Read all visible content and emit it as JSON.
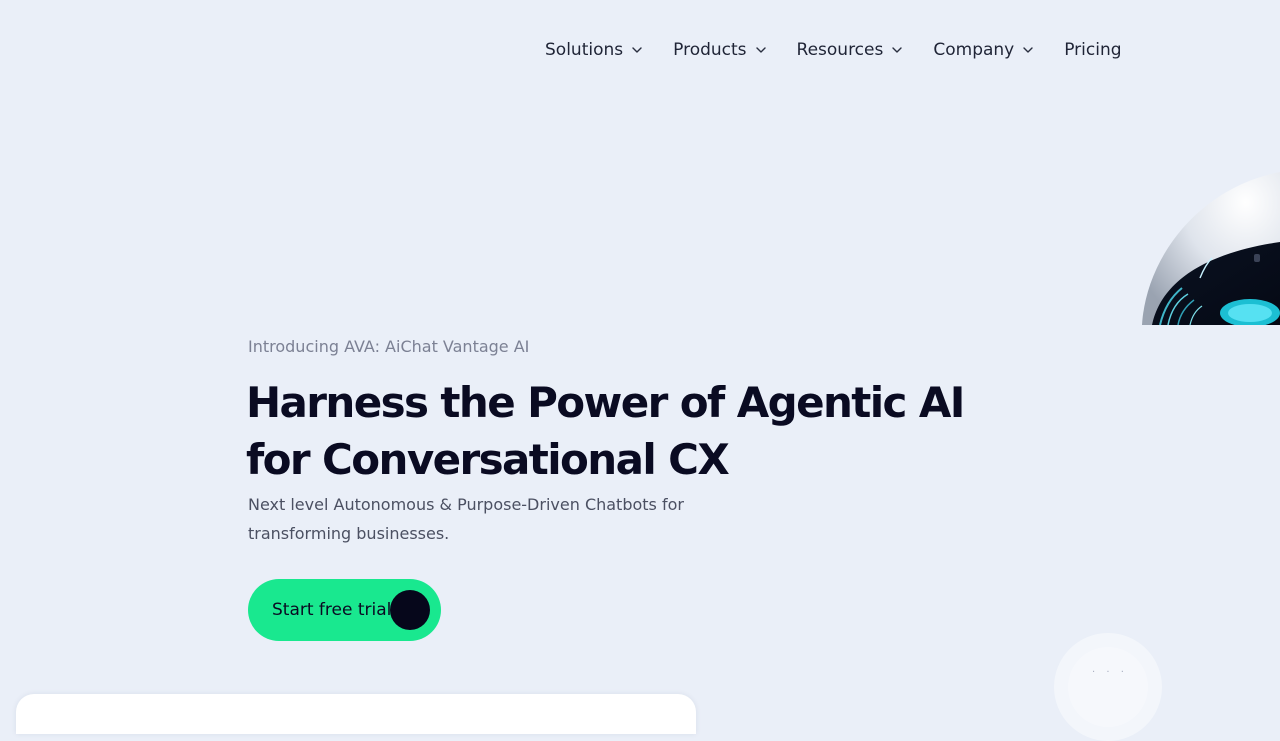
{
  "nav": {
    "items": [
      {
        "label": "Solutions",
        "has_dropdown": true
      },
      {
        "label": "Products",
        "has_dropdown": true
      },
      {
        "label": "Resources",
        "has_dropdown": true
      },
      {
        "label": "Company",
        "has_dropdown": true
      },
      {
        "label": "Pricing",
        "has_dropdown": false
      }
    ]
  },
  "hero": {
    "eyebrow": "Introducing AVA: AiChat Vantage AI",
    "headline_line1": "Harness the Power of Agentic AI",
    "headline_line2": "for Conversational CX",
    "subtext": "Next level Autonomous & Purpose-Driven Chatbots for transforming businesses.",
    "cta_label": "Start free trial"
  },
  "chat_widget": {
    "dots": "· · ·"
  },
  "colors": {
    "background": "#eaeff8",
    "accent_green": "#19e88f",
    "text_dark": "#0a0b22",
    "text_muted": "#7c8194"
  },
  "icons": {
    "nav_dropdown": "chevron-down-icon",
    "robot": "robot-illustration"
  }
}
